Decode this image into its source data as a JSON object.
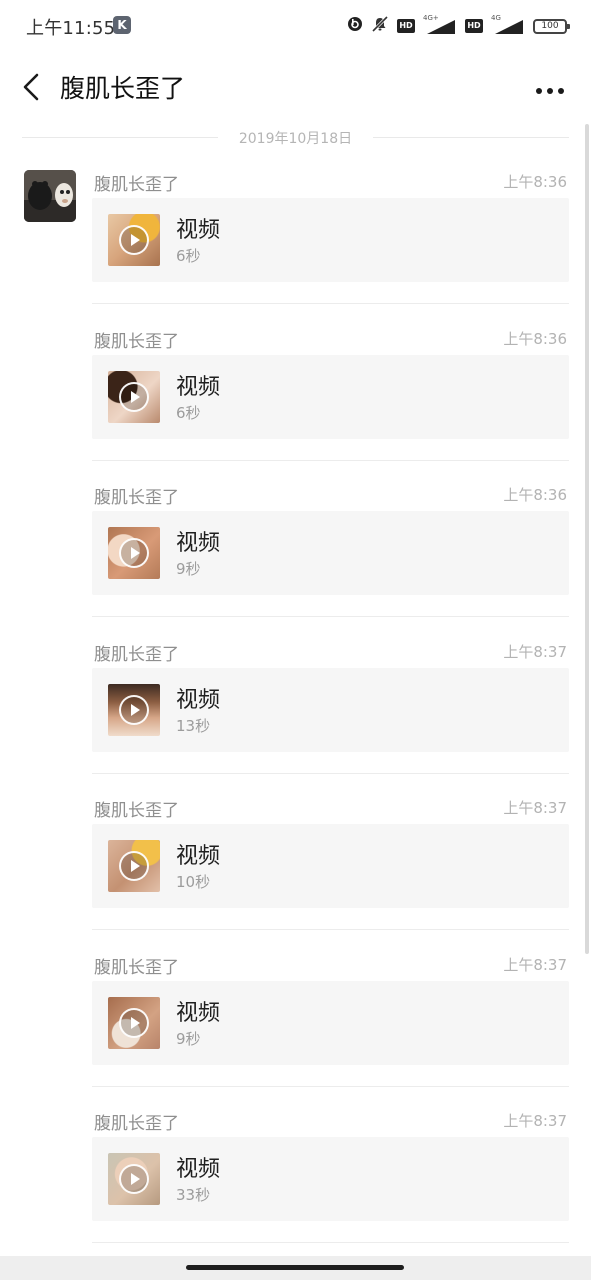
{
  "status_bar": {
    "time": "上午11:55",
    "app_icon_letter": "K",
    "icons": [
      "beats-icon",
      "mute-icon",
      "hd-icon",
      "signal-icon",
      "hd-icon",
      "signal-icon",
      "battery-icon"
    ],
    "hd_label": "HD",
    "net_label_1": "4G+",
    "net_label_2": "4G",
    "battery_level": "100"
  },
  "header": {
    "title": "腹肌长歪了",
    "back_icon": "chevron-left-icon",
    "more_icon": "more-dots-icon"
  },
  "date_divider": "2019年10月18日",
  "messages": [
    {
      "sender": "腹肌长歪了",
      "time": "上午8:36",
      "title": "视频",
      "duration": "6秒"
    },
    {
      "sender": "腹肌长歪了",
      "time": "上午8:36",
      "title": "视频",
      "duration": "6秒"
    },
    {
      "sender": "腹肌长歪了",
      "time": "上午8:36",
      "title": "视频",
      "duration": "9秒"
    },
    {
      "sender": "腹肌长歪了",
      "time": "上午8:37",
      "title": "视频",
      "duration": "13秒"
    },
    {
      "sender": "腹肌长歪了",
      "time": "上午8:37",
      "title": "视频",
      "duration": "10秒"
    },
    {
      "sender": "腹肌长歪了",
      "time": "上午8:37",
      "title": "视频",
      "duration": "9秒"
    },
    {
      "sender": "腹肌长歪了",
      "time": "上午8:37",
      "title": "视频",
      "duration": "33秒"
    }
  ],
  "colors": {
    "background": "#ffffff",
    "card": "#f6f6f6",
    "muted_text": "#8f8f8f",
    "time_text": "#b3b3b3"
  }
}
